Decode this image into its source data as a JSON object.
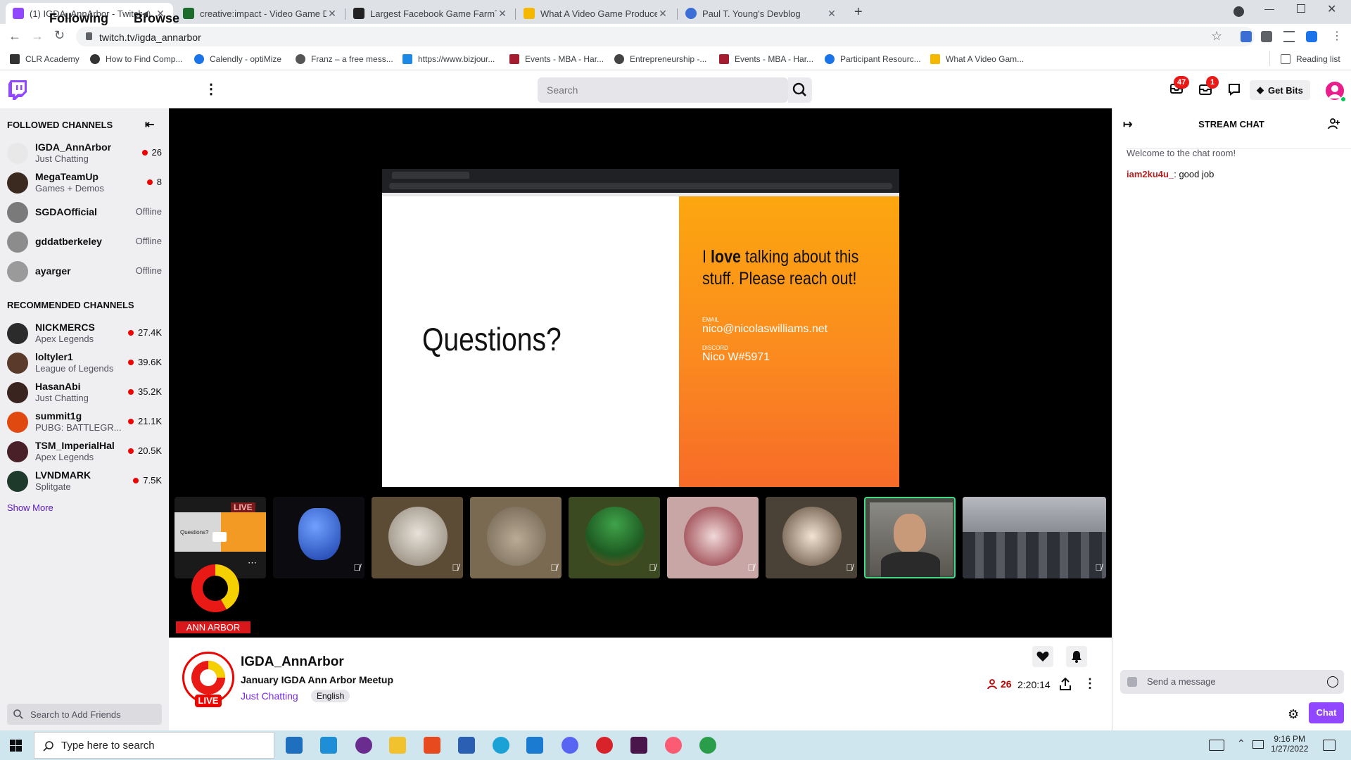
{
  "browser": {
    "tabs": [
      {
        "title": "(1) IGDA_AnnArbor - Twitch",
        "active": true
      },
      {
        "title": "creative:impact - Video Game De"
      },
      {
        "title": "Largest Facebook Game FarmTov"
      },
      {
        "title": "What A Video Game Producer Ac"
      },
      {
        "title": "Paul T. Young's Devblog"
      }
    ],
    "url": "twitch.tv/igda_annarbor",
    "bookmarks": [
      "CLR Academy",
      "How to Find Comp...",
      "Calendly - optiMize",
      "Franz – a free mess...",
      "https://www.bizjour...",
      "Events - MBA - Har...",
      "Entrepreneurship -...",
      "Events - MBA - Har...",
      "Participant Resourc...",
      "What A Video Gam..."
    ],
    "reading_list": "Reading list"
  },
  "nav": {
    "following": "Following",
    "browse": "Browse",
    "search_placeholder": "Search",
    "inbox_count": "47",
    "notif_count": "1",
    "get_bits": "Get Bits"
  },
  "sidebar": {
    "followed_heading": "FOLLOWED CHANNELS",
    "followed": [
      {
        "name": "IGDA_AnnArbor",
        "game": "Just Chatting",
        "viewers": "26",
        "color": "#e8e8e8"
      },
      {
        "name": "MegaTeamUp",
        "game": "Games + Demos",
        "viewers": "8",
        "color": "#3a2a20"
      },
      {
        "name": "SGDAOfficial",
        "status": "Offline",
        "color": "#7a7a7a"
      },
      {
        "name": "gddatberkeley",
        "status": "Offline",
        "color": "#8c8c8c"
      },
      {
        "name": "ayarger",
        "status": "Offline",
        "color": "#9a9a9a"
      }
    ],
    "recommended_heading": "RECOMMENDED CHANNELS",
    "recommended": [
      {
        "name": "NICKMERCS",
        "game": "Apex Legends",
        "viewers": "27.4K",
        "color": "#2b2b2b"
      },
      {
        "name": "loltyler1",
        "game": "League of Legends",
        "viewers": "39.6K",
        "color": "#5a3a2a"
      },
      {
        "name": "HasanAbi",
        "game": "Just Chatting",
        "viewers": "35.2K",
        "color": "#3a2420"
      },
      {
        "name": "summit1g",
        "game": "PUBG: BATTLEGR...",
        "viewers": "21.1K",
        "color": "#e04a10"
      },
      {
        "name": "TSM_ImperialHal",
        "game": "Apex Legends",
        "viewers": "20.5K",
        "color": "#4a2028"
      },
      {
        "name": "LVNDMARK",
        "game": "Splitgate",
        "viewers": "7.5K",
        "color": "#1e3a2a"
      }
    ],
    "show_more": "Show More",
    "friends_placeholder": "Search to Add Friends"
  },
  "video": {
    "slide": {
      "questions": "Questions?",
      "line1_pre": "I ",
      "line1_bold": "love",
      "line1_post": " talking about this",
      "line2": "stuff. Please reach out!",
      "email_label": "EMAIL",
      "email": "nico@nicolaswilliams.net",
      "discord_label": "DISCORD",
      "discord": "Nico W#5971"
    },
    "mini_live": "LIVE",
    "mini_questions": "Questions?",
    "logo_caption": "ANN ARBOR"
  },
  "stream": {
    "channel": "IGDA_AnnArbor",
    "title": "January IGDA Ann Arbor Meetup",
    "category": "Just Chatting",
    "tag": "English",
    "live": "LIVE",
    "viewers": "26",
    "uptime": "2:20:14"
  },
  "chat": {
    "header": "STREAM CHAT",
    "welcome": "Welcome to the chat room!",
    "messages": [
      {
        "user": "iam2ku4u_",
        "text": "good job",
        "color": "#b22222"
      }
    ],
    "placeholder": "Send a message",
    "button": "Chat"
  },
  "taskbar": {
    "search_placeholder": "Type here to search",
    "time": "9:16 PM",
    "date": "1/27/2022"
  },
  "colors": {
    "twitch_purple": "#9147ff",
    "live_red": "#eb0400",
    "taskbar": "#cfe6ef"
  }
}
